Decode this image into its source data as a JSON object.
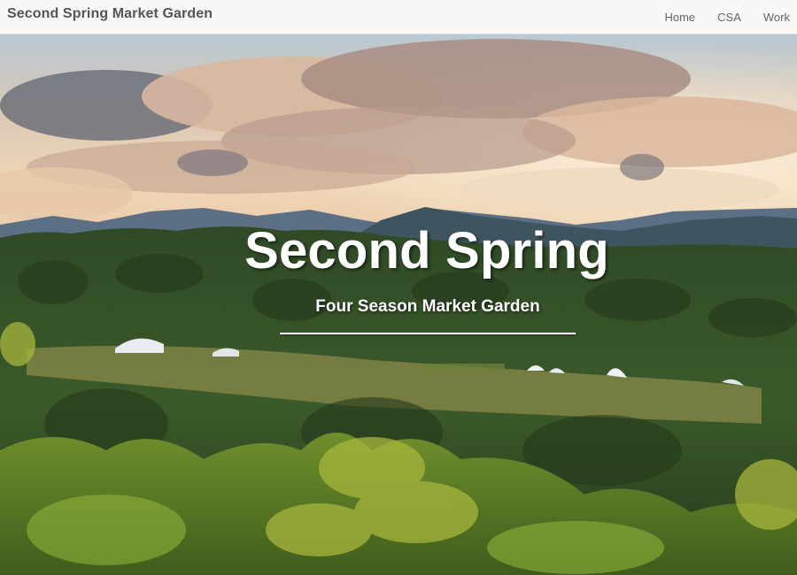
{
  "navbar": {
    "brand": "Second Spring Market Garden",
    "links": [
      {
        "label": "Home"
      },
      {
        "label": "CSA"
      },
      {
        "label": "Work"
      }
    ]
  },
  "hero": {
    "title": "Second Spring",
    "subtitle": "Four Season Market Garden"
  },
  "colors": {
    "navbar_bg": "#f8f8f8",
    "brand_text": "#555555",
    "hero_text": "#ffffff"
  }
}
